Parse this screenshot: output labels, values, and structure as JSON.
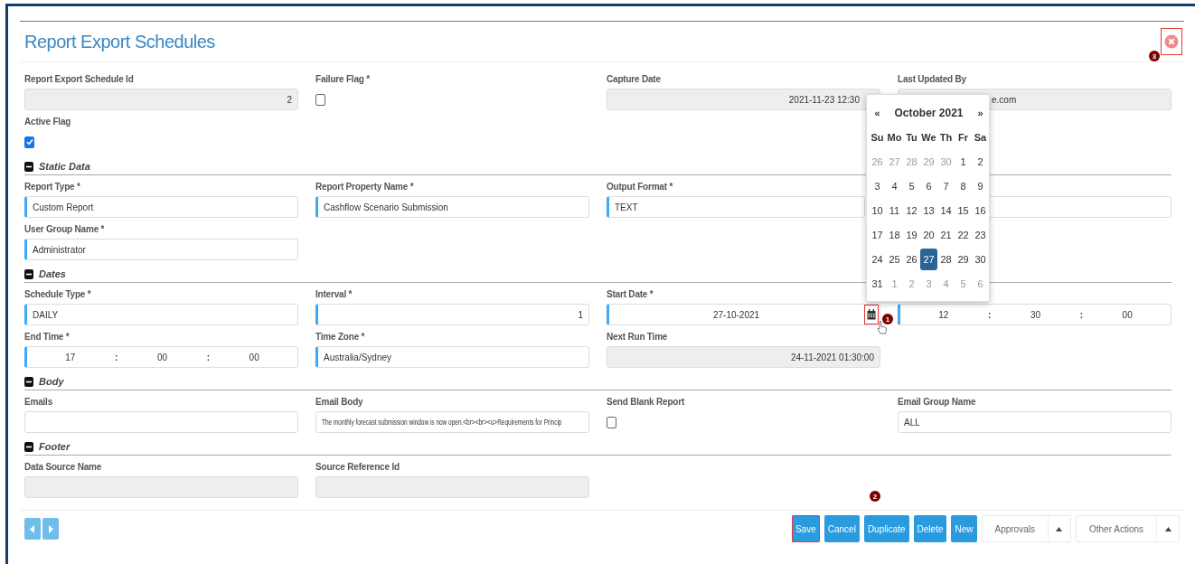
{
  "title": "Report Export Schedules",
  "close_button": {
    "highlighted": true
  },
  "sections": [
    {
      "rows": [
        [
          {
            "kind": "number",
            "label": "Report Export Schedule Id",
            "value": "2",
            "readonly": true
          },
          {
            "kind": "checkbox",
            "label": "Failure Flag *",
            "checked": false
          },
          {
            "kind": "datetime",
            "label": "Capture Date",
            "value": "2021-11-23 12:30",
            "readonly": true
          },
          {
            "kind": "text",
            "label": "Last Updated By",
            "value": "e.com",
            "readonly": true
          }
        ],
        [
          {
            "kind": "checkbox",
            "label": "Active Flag",
            "checked": true
          }
        ]
      ]
    },
    {
      "heading": "Static Data",
      "expanded": true,
      "rows": [
        [
          {
            "kind": "text",
            "label": "Report Type *",
            "value": "Custom Report",
            "required": true
          },
          {
            "kind": "text",
            "label": "Report Property Name *",
            "value": "Cashflow Scenario Submission",
            "required": true
          },
          {
            "kind": "text",
            "label": "Output Format *",
            "value": "TEXT",
            "required": true
          },
          {
            "kind": "text"
          }
        ],
        [
          {
            "kind": "text",
            "label": "User Group Name *",
            "value": "Administrator",
            "required": true
          }
        ]
      ]
    },
    {
      "heading": "Dates",
      "expanded": true,
      "rows": [
        [
          {
            "kind": "text",
            "label": "Schedule Type *",
            "value": "DAILY",
            "required": true
          },
          {
            "kind": "number",
            "label": "Interval *",
            "value": "1",
            "required": true
          },
          {
            "kind": "date",
            "label": "Start Date *",
            "value": "27-10-2021",
            "required": true,
            "calendar_highlighted": true
          },
          {
            "kind": "time",
            "required": true,
            "segments": [
              {
                "kind": "value",
                "text": "12"
              },
              {
                "kind": "separator",
                "text": ":"
              },
              {
                "kind": "value",
                "text": "30"
              },
              {
                "kind": "separator",
                "text": ":"
              },
              {
                "kind": "value",
                "text": "00"
              }
            ]
          }
        ],
        [
          {
            "kind": "time",
            "label": "End Time *",
            "required": true,
            "segments": [
              {
                "kind": "value",
                "text": "17"
              },
              {
                "kind": "separator",
                "text": ":"
              },
              {
                "kind": "value",
                "text": "00"
              },
              {
                "kind": "separator",
                "text": ":"
              },
              {
                "kind": "value",
                "text": "00"
              }
            ]
          },
          {
            "kind": "text",
            "label": "Time Zone *",
            "value": "Australia/Sydney",
            "required": true
          },
          {
            "kind": "datetime",
            "label": "Next Run Time",
            "value": "24-11-2021 01:30:00",
            "readonly": true
          }
        ]
      ]
    },
    {
      "heading": "Body",
      "expanded": true,
      "rows": [
        [
          {
            "kind": "text",
            "label": "Emails"
          },
          {
            "kind": "text",
            "label": "Email Body",
            "value": "The monthly forecast submission window is now open.<br><br><u>Requirements for Princip"
          },
          {
            "kind": "checkbox",
            "label": "Send Blank Report",
            "checked": false
          },
          {
            "kind": "text",
            "label": "Email Group Name",
            "value": "ALL"
          }
        ]
      ]
    },
    {
      "heading": "Footer",
      "expanded": true,
      "rows": [
        [
          {
            "kind": "text",
            "label": "Data Source Name",
            "readonly": true
          },
          {
            "kind": "text",
            "label": "Source Reference Id",
            "readonly": true
          }
        ]
      ]
    }
  ],
  "calendar": {
    "prev": "«",
    "month": "October 2021",
    "next": "»",
    "weekdays": [
      "Su",
      "Mo",
      "Tu",
      "We",
      "Th",
      "Fr",
      "Sa"
    ],
    "weeks": [
      [
        {
          "day": "26",
          "muted": true,
          "selected": false
        },
        {
          "day": "27",
          "muted": true,
          "selected": false
        },
        {
          "day": "28",
          "muted": true,
          "selected": false
        },
        {
          "day": "29",
          "muted": true,
          "selected": false
        },
        {
          "day": "30",
          "muted": true,
          "selected": false
        },
        {
          "day": "1",
          "muted": false,
          "selected": false
        },
        {
          "day": "2",
          "muted": false,
          "selected": false
        }
      ],
      [
        {
          "day": "3",
          "muted": false,
          "selected": false
        },
        {
          "day": "4",
          "muted": false,
          "selected": false
        },
        {
          "day": "5",
          "muted": false,
          "selected": false
        },
        {
          "day": "6",
          "muted": false,
          "selected": false
        },
        {
          "day": "7",
          "muted": false,
          "selected": false
        },
        {
          "day": "8",
          "muted": false,
          "selected": false
        },
        {
          "day": "9",
          "muted": false,
          "selected": false
        }
      ],
      [
        {
          "day": "10",
          "muted": false,
          "selected": false
        },
        {
          "day": "11",
          "muted": false,
          "selected": false
        },
        {
          "day": "12",
          "muted": false,
          "selected": false
        },
        {
          "day": "13",
          "muted": false,
          "selected": false
        },
        {
          "day": "14",
          "muted": false,
          "selected": false
        },
        {
          "day": "15",
          "muted": false,
          "selected": false
        },
        {
          "day": "16",
          "muted": false,
          "selected": false
        }
      ],
      [
        {
          "day": "17",
          "muted": false,
          "selected": false
        },
        {
          "day": "18",
          "muted": false,
          "selected": false
        },
        {
          "day": "19",
          "muted": false,
          "selected": false
        },
        {
          "day": "20",
          "muted": false,
          "selected": false
        },
        {
          "day": "21",
          "muted": false,
          "selected": false
        },
        {
          "day": "22",
          "muted": false,
          "selected": false
        },
        {
          "day": "23",
          "muted": false,
          "selected": false
        }
      ],
      [
        {
          "day": "24",
          "muted": false,
          "selected": false
        },
        {
          "day": "25",
          "muted": false,
          "selected": false
        },
        {
          "day": "26",
          "muted": false,
          "selected": false
        },
        {
          "day": "27",
          "muted": false,
          "selected": true
        },
        {
          "day": "28",
          "muted": false,
          "selected": false
        },
        {
          "day": "29",
          "muted": false,
          "selected": false
        },
        {
          "day": "30",
          "muted": false,
          "selected": false
        }
      ],
      [
        {
          "day": "31",
          "muted": false,
          "selected": false
        },
        {
          "day": "1",
          "muted": true,
          "selected": false
        },
        {
          "day": "2",
          "muted": true,
          "selected": false
        },
        {
          "day": "3",
          "muted": true,
          "selected": false
        },
        {
          "day": "4",
          "muted": true,
          "selected": false
        },
        {
          "day": "5",
          "muted": true,
          "selected": false
        },
        {
          "day": "6",
          "muted": true,
          "selected": false
        }
      ]
    ]
  },
  "buttons": [
    {
      "label": "Save",
      "kind": "primary",
      "highlighted": true
    },
    {
      "label": "Cancel",
      "kind": "primary",
      "highlighted": false
    },
    {
      "label": "Duplicate",
      "kind": "primary",
      "highlighted": false
    },
    {
      "label": "Delete",
      "kind": "primary",
      "highlighted": false
    },
    {
      "label": "New",
      "kind": "primary",
      "highlighted": false
    },
    {
      "label": "Approvals",
      "kind": "dropdown",
      "highlighted": false
    },
    {
      "label": "Other Actions",
      "kind": "dropdown",
      "highlighted": false
    }
  ],
  "annotations": [
    {
      "number": "1"
    },
    {
      "number": "2"
    },
    {
      "number": "3"
    }
  ]
}
